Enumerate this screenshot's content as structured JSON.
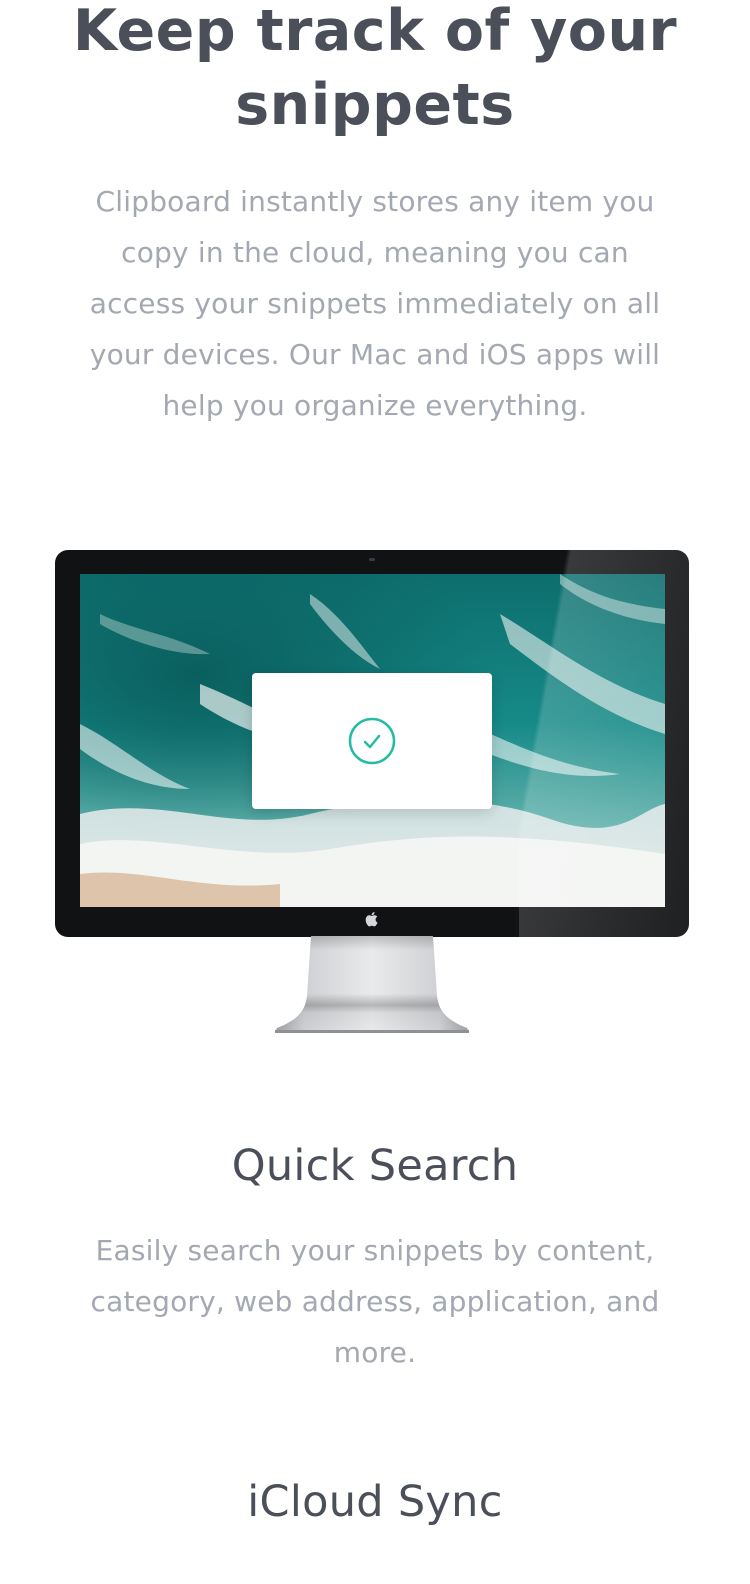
{
  "hero": {
    "title": "Keep track of your snippets",
    "text": "Clipboard instantly stores any item you copy in the cloud, meaning you can access your snippets immediately on all your devices. Our Mac and iOS apps will help you organize everything."
  },
  "monitor": {
    "screen_image": "ocean-waves-aerial",
    "dialog_icon": "check-circle-icon",
    "logo_icon": "apple-icon",
    "colors": {
      "check": "#26bba4",
      "bezel": "#111214"
    }
  },
  "features": [
    {
      "title": "Quick Search",
      "text": "Easily search your snippets by content, category, web address, application, and more."
    },
    {
      "title": "iCloud Sync"
    }
  ],
  "colors": {
    "heading": "#4b4f59",
    "body_text": "#a3a8b2",
    "accent": "#26bba4"
  }
}
